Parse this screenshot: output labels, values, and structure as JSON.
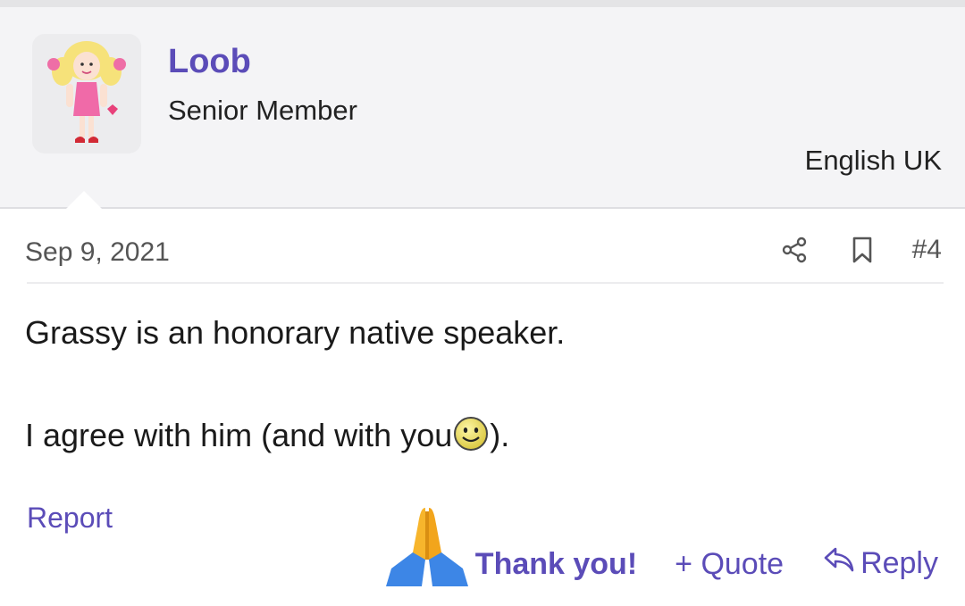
{
  "user": {
    "name": "Loob",
    "title": "Senior Member",
    "language": "English UK"
  },
  "post": {
    "date": "Sep 9, 2021",
    "number": "#4",
    "line1": "Grassy is an honorary native speaker.",
    "line2_before": "I agree with him (and with you",
    "line2_after": ")."
  },
  "icons": {
    "share": "share-icon",
    "bookmark": "bookmark-icon",
    "smiley": "smiley-icon",
    "pray": "pray-hands-icon",
    "reply": "reply-arrow-icon"
  },
  "actions": {
    "report": "Report",
    "thanks": "Thank you!",
    "quote": "+ Quote",
    "reply": "Reply"
  },
  "colors": {
    "accent": "#5b4cb8",
    "panel": "#f4f4f6"
  }
}
